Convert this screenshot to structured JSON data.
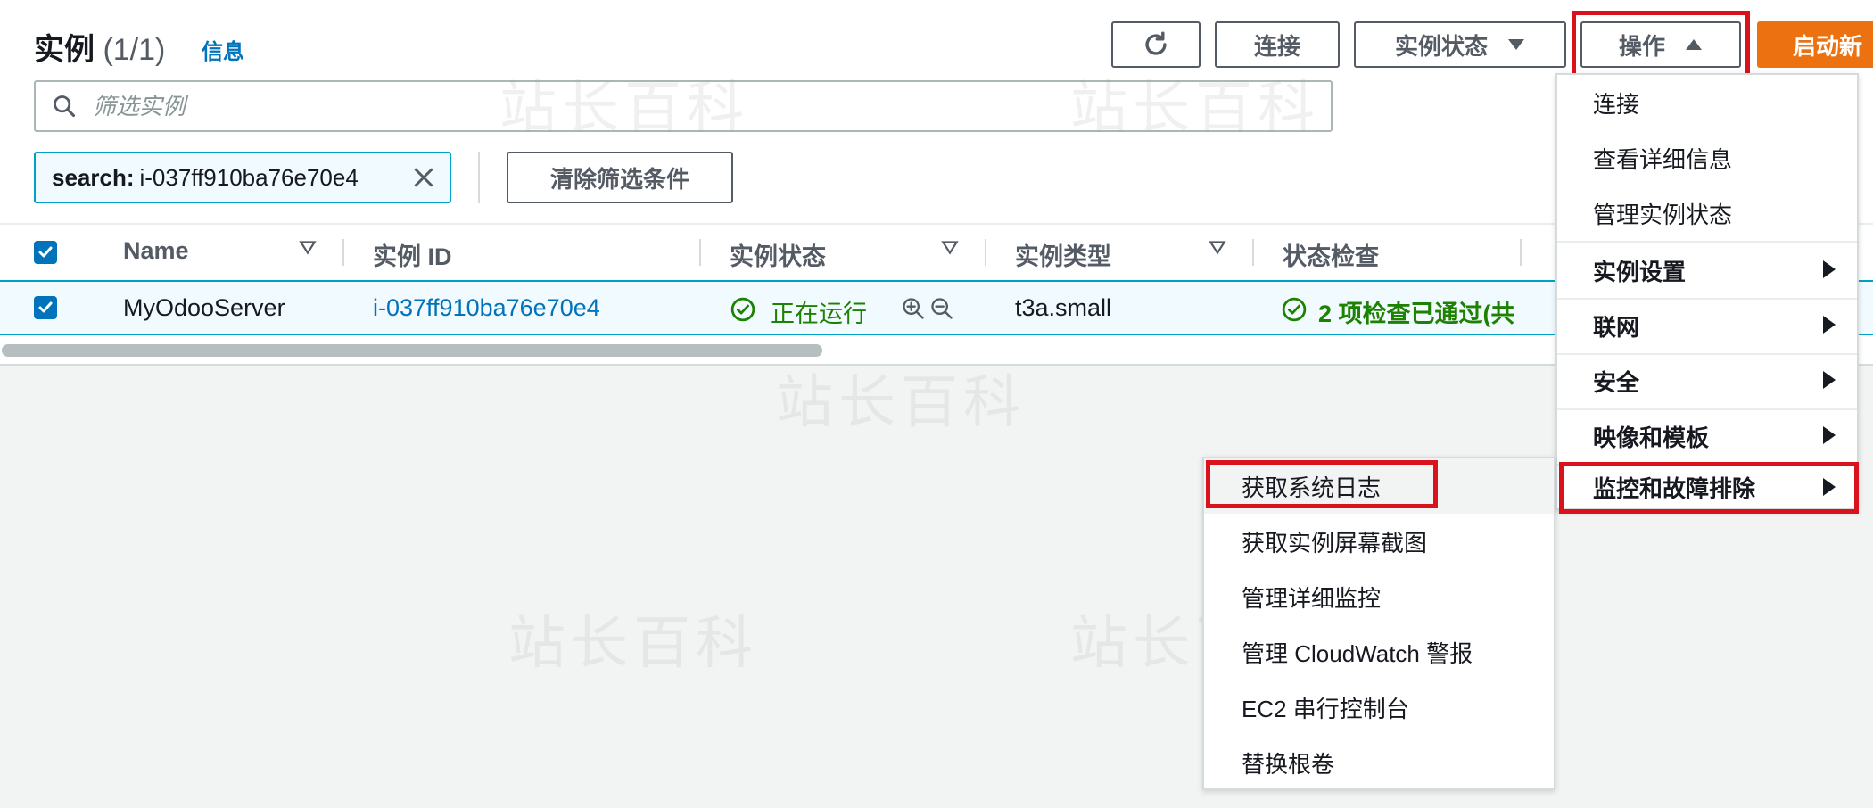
{
  "header": {
    "title": "实例",
    "count": "(1/1)",
    "info_link": "信息"
  },
  "toolbar": {
    "refresh_icon": "refresh-icon",
    "connect_label": "连接",
    "instance_state_label": "实例状态",
    "actions_label": "操作",
    "launch_label": "启动新"
  },
  "search": {
    "placeholder": "筛选实例"
  },
  "filter": {
    "token_key": "search:",
    "token_value": "i-037ff910ba76e70e4",
    "clear_label": "清除筛选条件"
  },
  "table": {
    "columns": [
      "Name",
      "实例 ID",
      "实例状态",
      "实例类型",
      "状态检查"
    ],
    "rows": [
      {
        "name": "MyOdooServer",
        "instance_id": "i-037ff910ba76e70e4",
        "state": "正在运行",
        "type": "t3a.small",
        "status_check": "2 项检查已通过(共"
      }
    ]
  },
  "actions_menu": {
    "items": [
      {
        "label": "连接",
        "bold": false,
        "submenu": false
      },
      {
        "label": "查看详细信息",
        "bold": false,
        "submenu": false
      },
      {
        "label": "管理实例状态",
        "bold": false,
        "submenu": false
      },
      {
        "label": "实例设置",
        "bold": true,
        "submenu": true
      },
      {
        "label": "联网",
        "bold": true,
        "submenu": true
      },
      {
        "label": "安全",
        "bold": true,
        "submenu": true
      },
      {
        "label": "映像和模板",
        "bold": true,
        "submenu": true
      },
      {
        "label": "监控和故障排除",
        "bold": true,
        "submenu": true
      }
    ]
  },
  "monitor_submenu": {
    "items": [
      "获取系统日志",
      "获取实例屏幕截图",
      "管理详细监控",
      "管理 CloudWatch 警报",
      "EC2 串行控制台",
      "替换根卷"
    ]
  },
  "colors": {
    "accent": "#0073bb",
    "launch": "#ec7211",
    "highlight": "#d9121c",
    "running": "#1d8102"
  },
  "watermark": "站长百科"
}
